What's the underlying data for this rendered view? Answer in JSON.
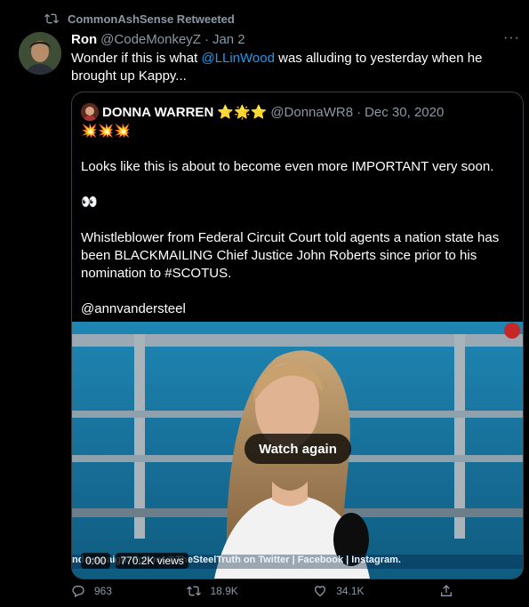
{
  "retweet": {
    "label": "CommonAshSense Retweeted"
  },
  "tweet": {
    "name": "Ron",
    "handle": "@CodeMonkeyZ",
    "dot": "·",
    "date": "Jan 2",
    "more": "···",
    "text_before": "Wonder if this is what ",
    "mention": "@LLinWood",
    "text_after": " was alluding to yesterday when he brought up Kappy..."
  },
  "quote": {
    "name": "DONNA WARREN",
    "name_emoji": "⭐🌟⭐",
    "handle": "@DonnaWR8",
    "dot": "·",
    "date": "Dec 30, 2020",
    "line1": "💥💥💥",
    "line2": "Looks like this is about to become even more IMPORTANT very soon.",
    "line3": "👀",
    "line4": "Whistleblower from Federal Circuit Court told agents a nation state has been BLACKMAILING Chief Justice John Roberts since prior to his nomination to #SCOTUS.",
    "line5": "@annvandersteel"
  },
  "video": {
    "watch_again": "Watch again",
    "ticker": "nd         ampaign.   Follow @TheSteelTruth on Twitter | Facebook | Instagram.",
    "time": "0:00",
    "views": "770.2K views"
  },
  "actions": {
    "replies": "963",
    "retweets": "18.9K",
    "likes": "34.1K"
  },
  "colors": {
    "link": "#1d9bf0",
    "muted": "#8b98a5",
    "background": "#000000"
  }
}
